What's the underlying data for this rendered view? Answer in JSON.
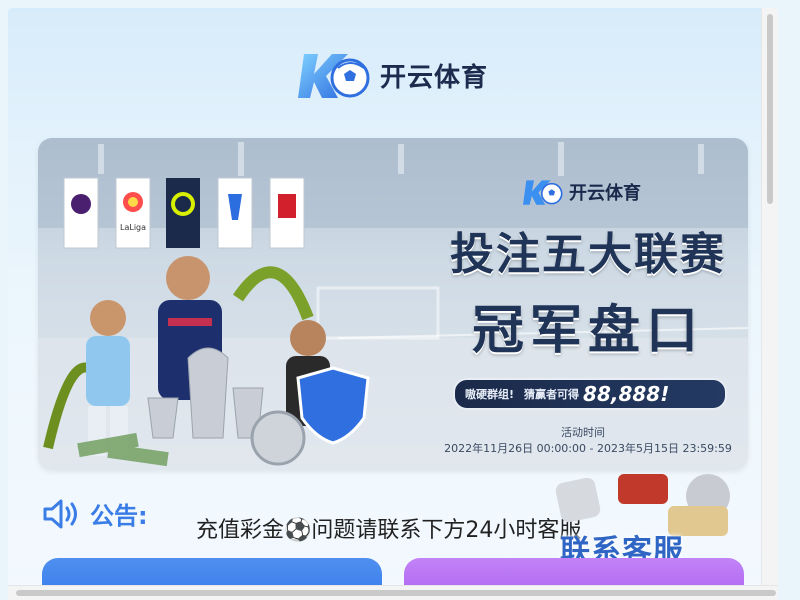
{
  "header": {
    "logo_text": "开云体育",
    "logo_icon": "k-soccer-ball-logo-icon"
  },
  "banner": {
    "logo_text": "开云体育",
    "headline_line1": "投注五大联赛",
    "headline_line2": "冠军盘口",
    "promo_left": "嗷硬群组!",
    "promo_mid": "猜赢者可得",
    "promo_amount": "88,888!",
    "activity_label": "活动时间",
    "activity_dates": "2022年11月26日 00:00:00 - 2023年5月15日 23:59:59",
    "flags": [
      "premier-league-flag",
      "laliga-flag",
      "ligue1-flag",
      "serie-a-flag",
      "bundesliga-flag"
    ],
    "flag_laliga_text": "LaLiga"
  },
  "notice": {
    "icon": "speaker-icon",
    "label": "公告:",
    "text": "充值彩金⚽问题请联系下方24小时客服",
    "customer_service": "联系客服"
  },
  "colors": {
    "accent_blue": "#3a7de6",
    "button_blue": "#2f74ea",
    "button_purple": "#a556ee",
    "headline_navy": "#1f3457"
  }
}
